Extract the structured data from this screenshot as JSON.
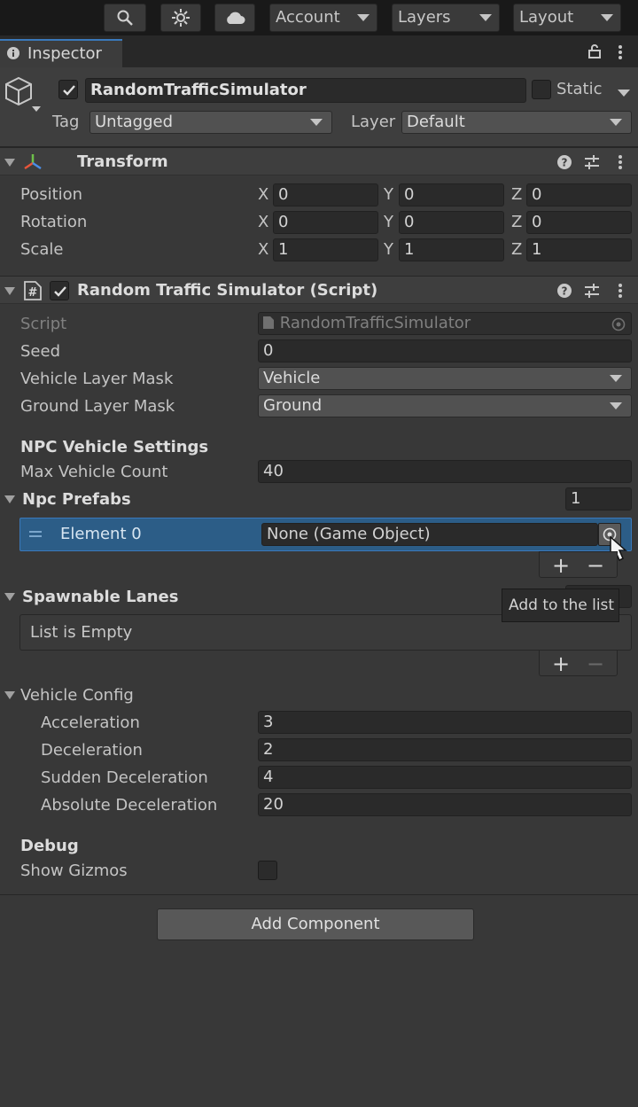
{
  "toolbar": {
    "account_label": "Account",
    "layers_label": "Layers",
    "layout_label": "Layout",
    "icons": [
      "search-icon",
      "settings-icon",
      "cloud-icon"
    ]
  },
  "tab": {
    "title": "Inspector"
  },
  "object": {
    "name": "RandomTrafficSimulator",
    "enabled": true,
    "static_label": "Static",
    "tag_label": "Tag",
    "tag_value": "Untagged",
    "layer_label": "Layer",
    "layer_value": "Default"
  },
  "transform": {
    "title": "Transform",
    "rows": [
      {
        "label": "Position",
        "x": "0",
        "y": "0",
        "z": "0"
      },
      {
        "label": "Rotation",
        "x": "0",
        "y": "0",
        "z": "0"
      },
      {
        "label": "Scale",
        "x": "1",
        "y": "1",
        "z": "1"
      }
    ],
    "axis_x": "X",
    "axis_y": "Y",
    "axis_z": "Z"
  },
  "script_component": {
    "title": "Random Traffic Simulator (Script)",
    "script_label": "Script",
    "script_value": "RandomTrafficSimulator",
    "seed_label": "Seed",
    "seed_value": "0",
    "vehicle_mask_label": "Vehicle Layer Mask",
    "vehicle_mask_value": "Vehicle",
    "ground_mask_label": "Ground Layer Mask",
    "ground_mask_value": "Ground",
    "npc_section": "NPC Vehicle Settings",
    "max_count_label": "Max Vehicle Count",
    "max_count_value": "40",
    "npc_prefabs_label": "Npc Prefabs",
    "npc_prefabs_size": "1",
    "element0_label": "Element 0",
    "element0_value": "None (Game Object)",
    "spawnable_label": "Spawnable Lanes",
    "list_empty": "List is Empty",
    "tooltip": "Add to the list",
    "plus": "+",
    "minus": "−",
    "vehicle_config_label": "Vehicle Config",
    "acceleration_label": "Acceleration",
    "acceleration_value": "3",
    "deceleration_label": "Deceleration",
    "deceleration_value": "2",
    "sudden_label": "Sudden Deceleration",
    "sudden_value": "4",
    "absolute_label": "Absolute Deceleration",
    "absolute_value": "20",
    "debug_label": "Debug",
    "show_gizmos_label": "Show Gizmos",
    "show_gizmos": false
  },
  "add_component_label": "Add Component"
}
